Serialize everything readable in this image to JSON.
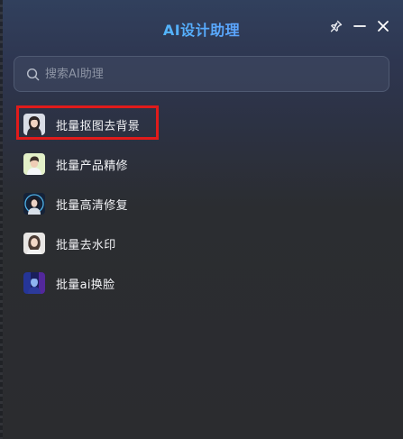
{
  "window": {
    "title": "AI设计助理",
    "title_gradient": [
      "#3fd6f4",
      "#5aa8ff",
      "#6f8bff"
    ],
    "controls": {
      "pin": "pin-icon",
      "minimize": "minimize-icon",
      "close": "close-icon"
    }
  },
  "search": {
    "placeholder": "搜索AI助理",
    "value": "",
    "icon": "search-icon"
  },
  "assistants": [
    {
      "label": "批量抠图去背景",
      "avatar": "woman-portrait-avatar",
      "highlighted": true
    },
    {
      "label": "批量产品精修",
      "avatar": "man-portrait-avatar",
      "highlighted": false
    },
    {
      "label": "批量高清修复",
      "avatar": "robot-woman-avatar",
      "highlighted": false
    },
    {
      "label": "批量去水印",
      "avatar": "woman-portrait-avatar",
      "highlighted": false
    },
    {
      "label": "批量ai换脸",
      "avatar": "cyber-face-avatar",
      "highlighted": false
    }
  ],
  "colors": {
    "highlight_border": "#e01b1b",
    "background_top": "#31405d",
    "background_bottom": "#2b2c2f"
  }
}
